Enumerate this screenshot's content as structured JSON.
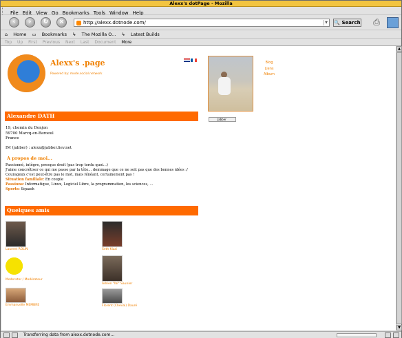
{
  "window": {
    "title": "Alexx's dotPage - Mozilla"
  },
  "menu": [
    "File",
    "Edit",
    "View",
    "Go",
    "Bookmarks",
    "Tools",
    "Window",
    "Help"
  ],
  "nav": {
    "url": "http://alexx.dotnode.com/",
    "search_label": "Search"
  },
  "bookmarks": [
    "Home",
    "Bookmarks",
    "The Mozilla O...",
    "Latest Builds"
  ],
  "sitenav": [
    "Top",
    "Up",
    "First",
    "Previous",
    "Next",
    "Last",
    "Document",
    "More"
  ],
  "status": {
    "text": "Transferring data from alexx.dotnode.com..."
  },
  "page": {
    "site_name": "Alexx's .page",
    "powered_by": "Powered by: mode.social.network",
    "side_links": [
      "Blog",
      "Liens",
      "Album"
    ],
    "badge": "Jabber",
    "name_header": "Alexandre DATH",
    "address": [
      "19, chemin du Donjon",
      "59700 Marcq-en-Baroeul",
      "France"
    ],
    "im": "IM (jabber) : alexx@jabber.liev.net",
    "about_title": "A propos de moi...",
    "bio_lines": [
      "Passionné, intègre, presque droit (pas trop tordu quoi...)",
      "J'aime concrétiser ce qui me passe par la tête... dommage que ce ne soit pas que des bonnes idées :/",
      "Courageux c'est peut-être pas le mot, mais fénéant, certainement pas !"
    ],
    "facts": [
      {
        "key": "Situation familiale:",
        "value": "En couple"
      },
      {
        "key": "Passions:",
        "value": "Informatique, Linux, Logiciel Libre, la programmation, les sciences, ..."
      },
      {
        "key": "Sports:",
        "value": "Squash"
      }
    ],
    "friends_header": "Quelques amis",
    "friends": [
      "Laurent ROLIN",
      "Seth Kizzi",
      "Moderator / Modérateur",
      "Adrien \"Ibi\" Saunier",
      "Emmanuelle MEMBRE",
      "Florent (Cheval) Dauré"
    ]
  },
  "colors": {
    "accent": "#ff6a00",
    "titlebar": "#f2c440"
  }
}
